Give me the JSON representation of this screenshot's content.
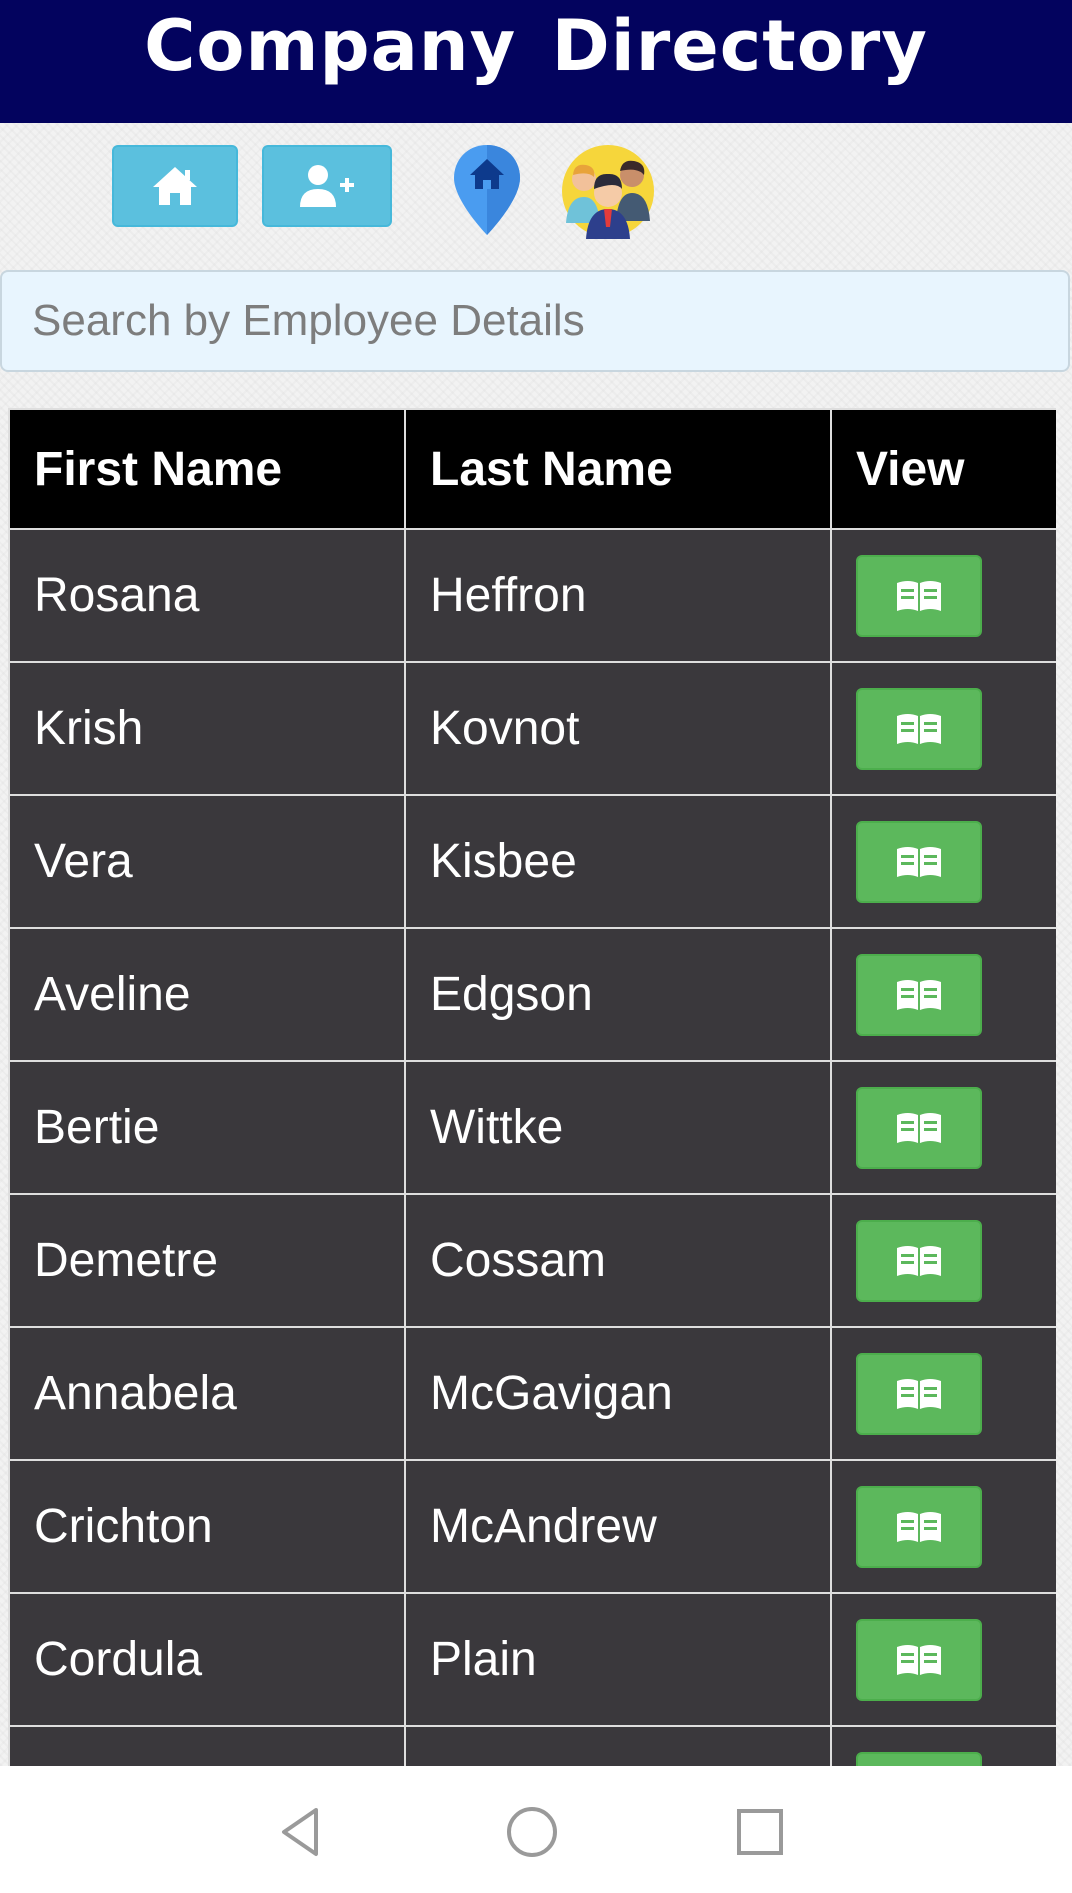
{
  "header": {
    "title": "Company  Directory"
  },
  "toolbar": {
    "home_icon": "home-icon",
    "add_user_icon": "user-plus-icon",
    "location_icon": "map-pin-home-icon",
    "team_icon": "team-people-icon"
  },
  "search": {
    "placeholder": "Search by Employee Details",
    "value": ""
  },
  "table": {
    "columns": [
      "First Name",
      "Last Name",
      "View"
    ],
    "rows": [
      {
        "first": "Rosana",
        "last": "Heffron"
      },
      {
        "first": "Krish",
        "last": "Kovnot"
      },
      {
        "first": "Vera",
        "last": "Kisbee"
      },
      {
        "first": "Aveline",
        "last": "Edgson"
      },
      {
        "first": "Bertie",
        "last": "Wittke"
      },
      {
        "first": "Demetre",
        "last": "Cossam"
      },
      {
        "first": "Annabela",
        "last": "McGavigan"
      },
      {
        "first": "Crichton",
        "last": "McAndrew"
      },
      {
        "first": "Cordula",
        "last": "Plain"
      },
      {
        "first": "",
        "last": ""
      }
    ],
    "view_icon": "open-book-icon"
  },
  "colors": {
    "header_bg": "#03035e",
    "info_button": "#5bc0de",
    "success_button": "#5cb85c",
    "row_bg": "#3a383c",
    "header_row_bg": "#000000"
  },
  "system_nav": {
    "back_icon": "back-triangle-icon",
    "home_icon": "home-circle-icon",
    "recents_icon": "recents-square-icon"
  }
}
